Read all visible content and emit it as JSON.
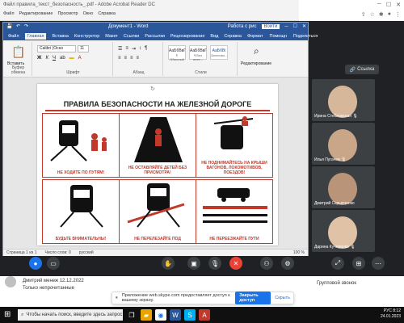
{
  "acrobat": {
    "title": "Файл правила_текст_безопасность_.pdf - Adobe Acrobat Reader DC",
    "menu": [
      "Файл",
      "Редактирование",
      "Просмотр",
      "Окно",
      "Справка"
    ]
  },
  "word": {
    "title": "Документ1 - Word",
    "signin": "Войти",
    "user": "Работа с рис",
    "tabs": [
      "Файл",
      "Главная",
      "Вставка",
      "Конструктор",
      "Макет",
      "Ссылки",
      "Рассылки",
      "Рецензирование",
      "Вид",
      "Справка"
    ],
    "tabs_right": [
      "Формат",
      "Помощн",
      "Поделиться"
    ],
    "ribbon": {
      "paste": "Вставить",
      "font_name": "Calibri (Осно",
      "font_size": "11",
      "groups": [
        "Буфер обмена",
        "Шрифт",
        "Абзац",
        "Стили",
        "Редактирование"
      ],
      "styles": [
        {
          "sample": "АаБбВвГ",
          "name": "¶ Обычный"
        },
        {
          "sample": "АаБбВвГ",
          "name": "¶ Без инте..."
        },
        {
          "sample": "АаБбВі",
          "name": "Заголово..."
        }
      ],
      "editing": "Редактирование"
    },
    "status": {
      "page": "Страница 1 из 1",
      "words": "Число слов: 0",
      "lang": "русский",
      "zoom": "100 %"
    }
  },
  "poster": {
    "title": "ПРАВИЛА БЕЗОПАСНОСТИ НА ЖЕЛЕЗНОЙ ДОРОГЕ",
    "cells": [
      "НЕ ХОДИТЕ ПО ПУТЯМ!",
      "НЕ ОСТАВЛЯЙТЕ ДЕТЕЙ БЕЗ ПРИСМОТРА!",
      "НЕ ПОДНИМАЙТЕСЬ НА КРЫШИ ВАГОНОВ, ЛОКОМОТИВОВ, ПОЕЗДОВ!",
      "БУДЬТЕ ВНИМАТЕЛЬНЫ!",
      "НЕ ПЕРЕЛЕЗАЙТЕ ПОД",
      "НЕ ПЕРЕЕЗЖАЙТЕ ПУТИ"
    ]
  },
  "meet": {
    "link_label": "Ссылка",
    "participants": [
      "Ирина Стебловская 🎙",
      "Илья Пугачев 🎙",
      "Дмитрий Скрыпченко",
      "Дарина Кучеренко 🎙"
    ]
  },
  "chat": {
    "entry": "Дмитрий менеж 12.12.2022",
    "entry2": "Только непрочитанные",
    "side": "Групповой звонок"
  },
  "notification": {
    "text": "Приложение web.skype.com предоставляет доступ к вашему экрану.",
    "button": "Закрыть доступ",
    "hide": "Скрыть"
  },
  "taskbar": {
    "search_placeholder": "Чтобы начать поиск, введите здесь запрос",
    "time": "8:12",
    "date": "24.01.2023",
    "lang": "РУС"
  },
  "colors": {
    "accent": "#2b579a",
    "danger": "#c0392b",
    "meet_bg": "#202124",
    "blue": "#1a73e8"
  }
}
